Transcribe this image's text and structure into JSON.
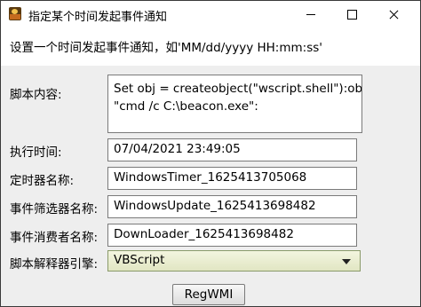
{
  "window": {
    "title": "指定某个时间发起事件通知"
  },
  "instruction": "设置一个时间发起事件通知，如'MM/dd/yyyy HH:mm:ss'",
  "form": {
    "script_label": "脚本内容:",
    "script_lines": [
      "Set obj = createobject(\"wscript.shell\"):obj.run",
      "\"cmd /c C:\\beacon.exe\":"
    ],
    "exec_time_label": "执行时间:",
    "exec_time_value": "07/04/2021 23:49:05",
    "timer_name_label": "定时器名称:",
    "timer_name_value": "WindowsTimer_1625413705068",
    "filter_name_label": "事件筛选器名称:",
    "filter_name_value": "WindowsUpdate_1625413698482",
    "consumer_name_label": "事件消费者名称:",
    "consumer_name_value": "DownLoader_1625413698482",
    "engine_label": "脚本解释器引擎:",
    "engine_value": "VBScript"
  },
  "buttons": {
    "regwmi": "RegWMI"
  },
  "icons": {
    "app": "app-icon",
    "minimize": "minimize-icon",
    "maximize": "maximize-icon",
    "close": "close-icon",
    "dropdown": "chevron-down-icon"
  }
}
